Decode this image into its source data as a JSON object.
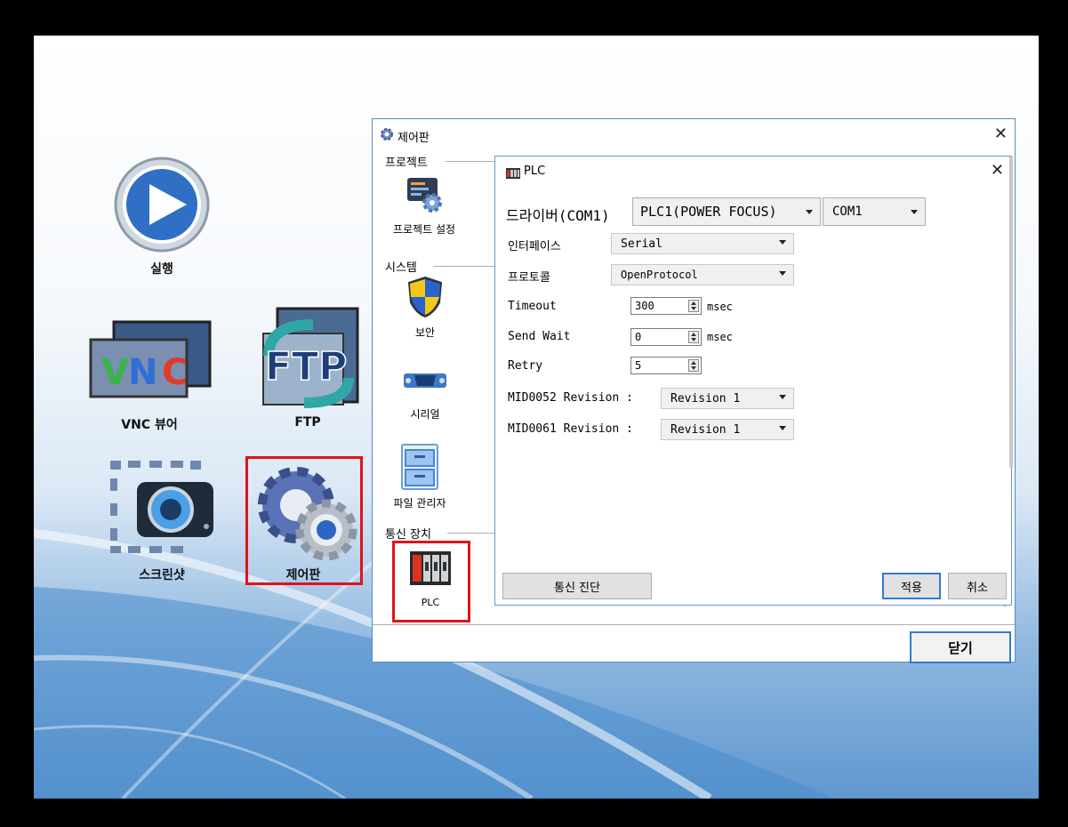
{
  "desktop": {
    "icons": [
      {
        "name": "run",
        "label": "실행"
      },
      {
        "name": "vnc-viewer",
        "label": "VNC 뷰어"
      },
      {
        "name": "ftp",
        "label": "FTP"
      },
      {
        "name": "screenshot",
        "label": "스크린샷"
      },
      {
        "name": "control-panel",
        "label": "제어판"
      }
    ]
  },
  "control_panel": {
    "title": "제어판",
    "sections": {
      "project": "프로젝트",
      "system": "시스템",
      "comm": "통신 장치"
    },
    "items": {
      "project_settings": "프로젝트 설정",
      "security": "보안",
      "serial": "시리얼",
      "file_manager": "파일 관리자",
      "plc": "PLC"
    },
    "close_label": "닫기"
  },
  "plc_dialog": {
    "title": "PLC",
    "driver_label": "드라이버(COM1)",
    "driver_value": "PLC1(POWER FOCUS)",
    "port_value": "COM1",
    "interface_label": "인터페이스",
    "interface_value": "Serial",
    "protocol_label": "프로토콜",
    "protocol_value": "OpenProtocol",
    "timeout_label": "Timeout",
    "timeout_value": "300",
    "timeout_unit": "msec",
    "sendwait_label": "Send Wait",
    "sendwait_value": "0",
    "sendwait_unit": "msec",
    "retry_label": "Retry",
    "retry_value": "5",
    "mid52_label": "MID0052 Revision :",
    "mid52_value": "Revision 1",
    "mid61_label": "MID0061 Revision :",
    "mid61_value": "Revision 1",
    "diag_button": "통신 진단",
    "apply_button": "적용",
    "cancel_button": "취소"
  },
  "colors": {
    "highlight": "#e0131a",
    "accent": "#2e7ad6"
  }
}
